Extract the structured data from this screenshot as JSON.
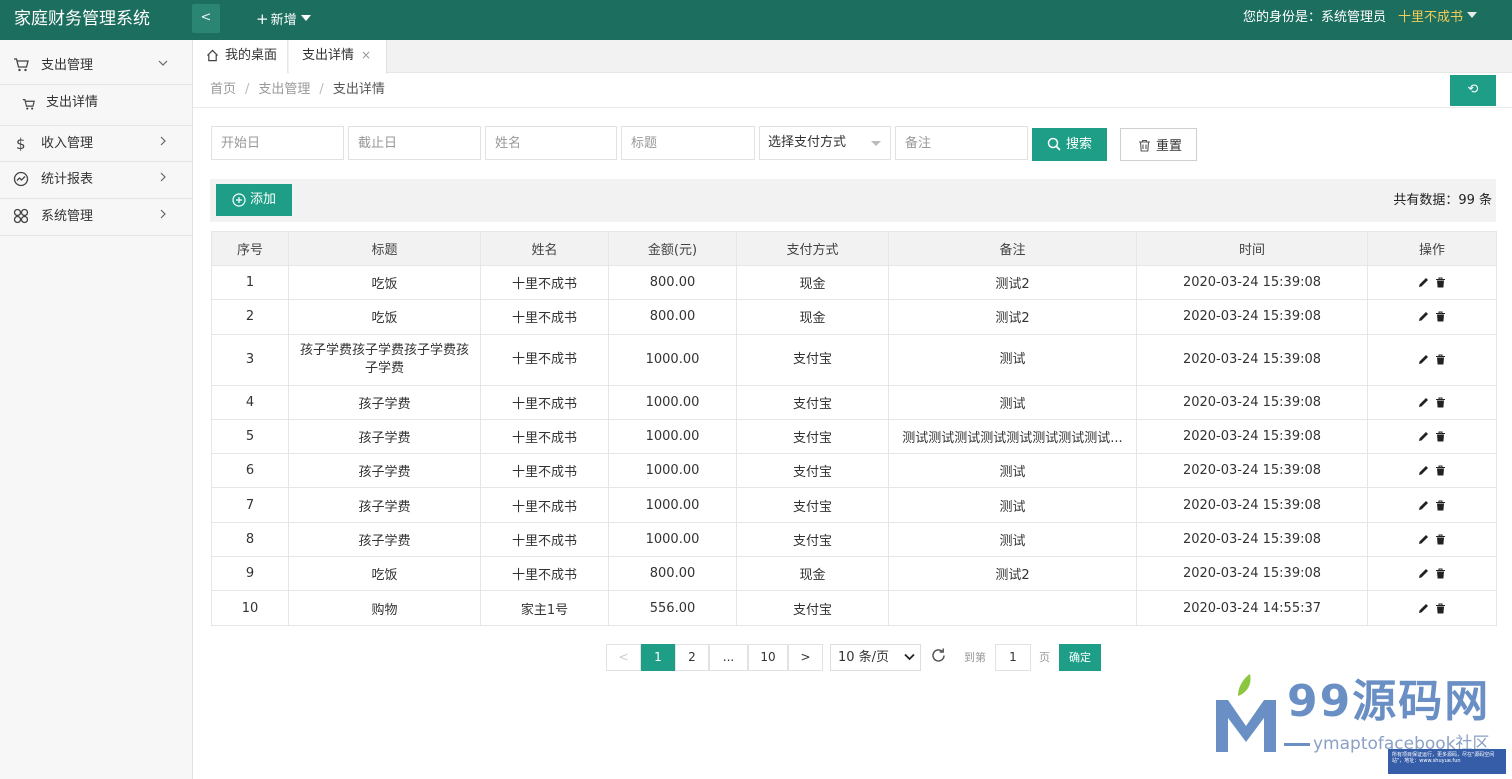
{
  "app": {
    "title": "家庭财务管理系统",
    "collapse_glyph": "<",
    "new_menu_label": "新增",
    "identity_text": "您的身份是：系统管理员",
    "user_name": "十里不成书"
  },
  "sidebar": {
    "items": [
      {
        "label": "支出管理",
        "icon": "cart-icon",
        "expanded": true
      },
      {
        "label": "支出详情",
        "icon": "cart-icon"
      },
      {
        "label": "收入管理",
        "icon": "dollar-icon",
        "expanded": false
      },
      {
        "label": "统计报表",
        "icon": "chart-line-icon",
        "expanded": false
      },
      {
        "label": "系统管理",
        "icon": "grid-icon",
        "expanded": false
      }
    ]
  },
  "tabs": [
    {
      "label": "我的桌面",
      "icon": "home-icon"
    },
    {
      "label": "支出详情",
      "close": "×"
    }
  ],
  "breadcrumb": [
    "首页",
    "支出管理",
    "支出详情"
  ],
  "breadcrumb_sep": "/",
  "refresh_glyph": "⟲",
  "filters": {
    "start_placeholder": "开始日",
    "end_placeholder": "截止日",
    "name_placeholder": "姓名",
    "title_placeholder": "标题",
    "pay_method_selected": "选择支付方式",
    "remark_placeholder": "备注",
    "search_label": "搜索",
    "reset_label": "重置"
  },
  "toolbar": {
    "add_label": "添加",
    "total_label": "共有数据：99 条"
  },
  "table": {
    "columns": [
      "序号",
      "标题",
      "姓名",
      "金额(元)",
      "支付方式",
      "备注",
      "时间",
      "操作"
    ],
    "rows": [
      [
        "1",
        "吃饭",
        "十里不成书",
        "800.00",
        "现金",
        "测试2",
        "2020-03-24 15:39:08"
      ],
      [
        "2",
        "吃饭",
        "十里不成书",
        "800.00",
        "现金",
        "测试2",
        "2020-03-24 15:39:08"
      ],
      [
        "3",
        "孩子学费孩子学费孩子学费孩子学费",
        "十里不成书",
        "1000.00",
        "支付宝",
        "测试",
        "2020-03-24 15:39:08"
      ],
      [
        "4",
        "孩子学费",
        "十里不成书",
        "1000.00",
        "支付宝",
        "测试",
        "2020-03-24 15:39:08"
      ],
      [
        "5",
        "孩子学费",
        "十里不成书",
        "1000.00",
        "支付宝",
        "测试测试测试测试测试测试测试测试...",
        "2020-03-24 15:39:08"
      ],
      [
        "6",
        "孩子学费",
        "十里不成书",
        "1000.00",
        "支付宝",
        "测试",
        "2020-03-24 15:39:08"
      ],
      [
        "7",
        "孩子学费",
        "十里不成书",
        "1000.00",
        "支付宝",
        "测试",
        "2020-03-24 15:39:08"
      ],
      [
        "8",
        "孩子学费",
        "十里不成书",
        "1000.00",
        "支付宝",
        "测试",
        "2020-03-24 15:39:08"
      ],
      [
        "9",
        "吃饭",
        "十里不成书",
        "800.00",
        "现金",
        "测试2",
        "2020-03-24 15:39:08"
      ],
      [
        "10",
        "购物",
        "家主1号",
        "556.00",
        "支付宝",
        "",
        "2020-03-24 14:55:37"
      ]
    ]
  },
  "pagination": {
    "prev": "<",
    "pages": [
      "1",
      "2",
      "...",
      "10"
    ],
    "active_page": "1",
    "next": ">",
    "per_page": "10 条/页",
    "goto_prefix": "到第",
    "goto_value": "1",
    "goto_suffix": "页",
    "confirm": "确定"
  },
  "watermark": {
    "brand": "99源码网",
    "sub": "ymaptofacebook社区",
    "note": "所有项目保证运行，更多源码，尽在\"源码空间站\"，地址：www.shuyue.fun"
  },
  "colors": {
    "header": "#1c6e5f",
    "accent": "#1e9e87",
    "user_name": "#f2cc5a"
  }
}
